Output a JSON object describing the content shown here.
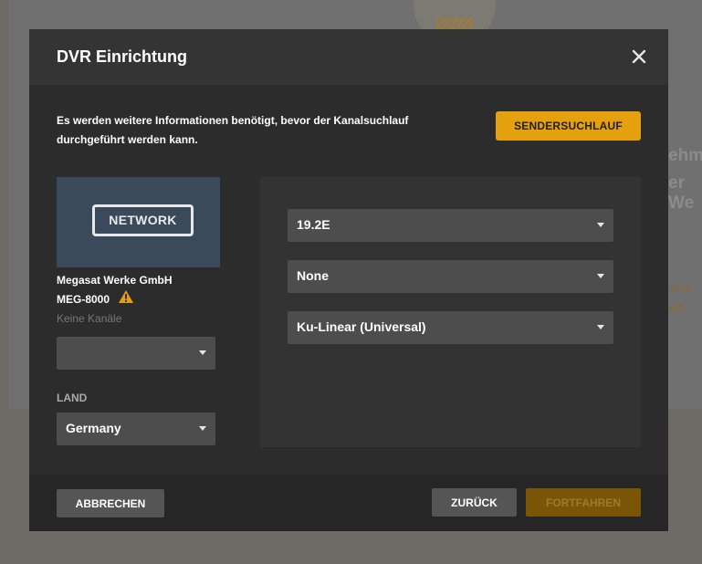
{
  "background": {
    "partial_text_1": "ehme",
    "partial_text_2": "er We",
    "warning_partial_1": "st of",
    "warning_partial_2": "ell!"
  },
  "modal": {
    "title": "DVR Einrichtung",
    "close_icon": "close-icon",
    "info_text": "Es werden weitere Informationen benötigt, bevor der Kanalsuchlauf durchgeführt werden kann.",
    "scan_button": "SENDERSUCHLAUF",
    "device": {
      "thumbnail_label": "NETWORK",
      "vendor": "Megasat Werke GmbH",
      "model": "MEG-8000",
      "channels": "Keine Kanäle",
      "warning_icon": "warning-icon"
    },
    "left_select_value": "",
    "country_label": "LAND",
    "country_value": "Germany",
    "satellite_options": [
      "19.2E",
      "None",
      "Ku-Linear (Universal)"
    ],
    "footer": {
      "cancel": "ABBRECHEN",
      "back": "ZURÜCK",
      "next": "FORTFAHREN"
    }
  },
  "colors": {
    "accent": "#e5a00d",
    "accent_disabled": "#7a5506",
    "modal_bg": "#2c2c2c",
    "select_bg": "#4d4d4d"
  }
}
